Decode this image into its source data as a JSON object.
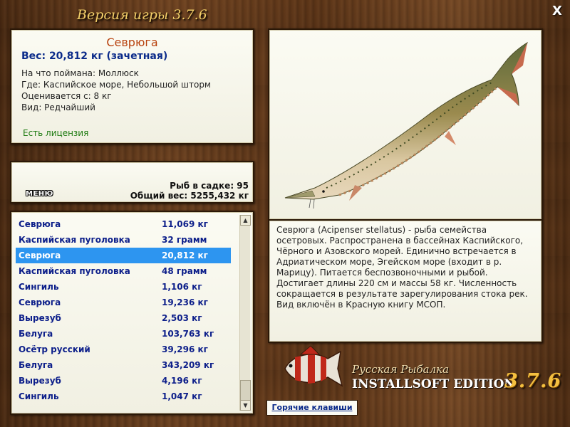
{
  "window": {
    "title": "Версия игры 3.7.6",
    "close_label": "X"
  },
  "fish_info": {
    "name": "Севрюга",
    "weight": "Вес: 20,812 кг (зачетная)",
    "lines": [
      "На что поймана: Моллюск",
      "Где: Каспийское море, Небольшой шторм",
      "Оценивается с: 8 кг",
      "Вид: Редчайший"
    ],
    "license": "Есть лицензия"
  },
  "summary": {
    "menu_label": "МЕНЮ",
    "count": "Рыб в садке: 95",
    "total": "Общий вес: 5255,432 кг"
  },
  "catch_list": [
    {
      "name": "Севрюга",
      "weight": "11,069 кг"
    },
    {
      "name": "Каспийская пуголовка",
      "weight": "32 грамм"
    },
    {
      "name": "Севрюга",
      "weight": "20,812 кг"
    },
    {
      "name": "Каспийская пуголовка",
      "weight": "48 грамм"
    },
    {
      "name": "Сингиль",
      "weight": "1,106 кг"
    },
    {
      "name": "Севрюга",
      "weight": "19,236 кг"
    },
    {
      "name": "Вырезуб",
      "weight": "2,503 кг"
    },
    {
      "name": "Белуга",
      "weight": "103,763 кг"
    },
    {
      "name": "Осётр русский",
      "weight": "39,296 кг"
    },
    {
      "name": "Белуга",
      "weight": "343,209 кг"
    },
    {
      "name": "Вырезуб",
      "weight": "4,196 кг"
    },
    {
      "name": "Сингиль",
      "weight": "1,047 кг"
    }
  ],
  "selected_index": 2,
  "scrollbar": {
    "up_icon": "▲",
    "down_icon": "▼"
  },
  "description": "Севрюга (Acipenser stellatus) - рыба семейства осетровых. Распространена в бассейнах Каспийского, Чёрного и Азовского морей. Единично встречается в Адриатическом море, Эгейском море (входит в р. Марицу). Питается беспозвоночными и рыбой. Достигает длины 220 см и массы 58 кг. Численность сокращается в результате зарегулирования стока рек. Вид включён в Красную книгу МСОП.",
  "logo": {
    "line1": "Русская Рыбалка",
    "line2": "INSTALLSOFT EDITION",
    "version": "3.7.6"
  },
  "hotkeys_label": "Горячие клавиши",
  "colors": {
    "accent_blue": "#0b2b8a",
    "selection": "#2d95f0",
    "fish_name": "#b8420e",
    "license": "#1d7a10",
    "version_gold": "#f4c040"
  },
  "icons": {
    "close": "close-icon",
    "fish_picture": "sturgeon-illustration",
    "logo": "red-white-fish-logo"
  }
}
